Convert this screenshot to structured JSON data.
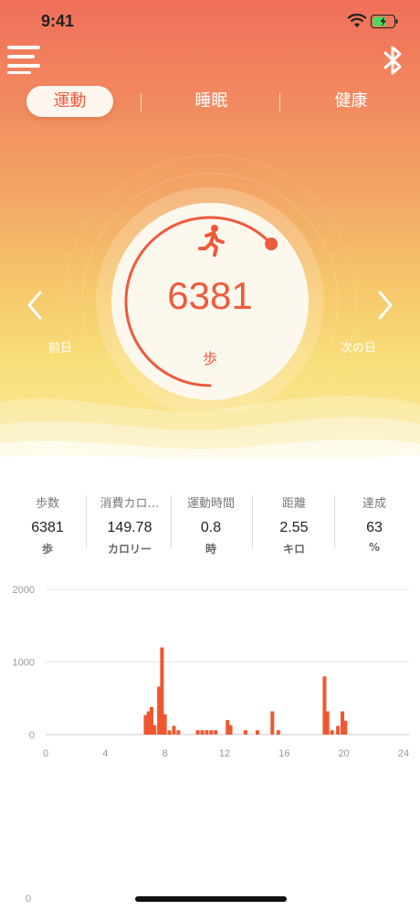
{
  "status": {
    "time": "9:41"
  },
  "tabs": [
    {
      "label": "運動",
      "active": true
    },
    {
      "label": "睡眠",
      "active": false
    },
    {
      "label": "健康",
      "active": false
    }
  ],
  "summary": {
    "steps": "6381",
    "unit": "歩",
    "prev_label": "前日",
    "next_label": "次の日",
    "goal_progress": 0.63,
    "icon": "running-person-icon"
  },
  "stats": [
    {
      "label": "歩数",
      "value": "6381",
      "unit": "歩"
    },
    {
      "label": "消費カロ…",
      "value": "149.78",
      "unit": "カロリー"
    },
    {
      "label": "運動時間",
      "value": "0.8",
      "unit": "時"
    },
    {
      "label": "距離",
      "value": "2.55",
      "unit": "キロ"
    },
    {
      "label": "達成",
      "value": "63",
      "unit": "%"
    }
  ],
  "colors": {
    "accent": "#ef5a3c",
    "bar": "#f0572f"
  },
  "chart_data": {
    "type": "bar",
    "x_ticks": [
      "0",
      "4",
      "8",
      "12",
      "16",
      "20",
      "24"
    ],
    "y_ticks": [
      "0",
      "1000",
      "2000"
    ],
    "ylim": [
      0,
      2000
    ],
    "xlim": [
      0,
      24
    ],
    "x": [
      6.7,
      6.9,
      7.1,
      7.3,
      7.6,
      7.8,
      8.0,
      8.3,
      8.6,
      8.9,
      10.2,
      10.5,
      10.8,
      11.1,
      11.4,
      12.2,
      12.4,
      13.4,
      14.2,
      15.2,
      15.6,
      18.7,
      18.9,
      19.2,
      19.6,
      19.9,
      20.1
    ],
    "values": [
      270,
      320,
      380,
      130,
      660,
      1200,
      280,
      60,
      120,
      60,
      60,
      60,
      60,
      60,
      60,
      200,
      130,
      60,
      60,
      320,
      60,
      800,
      320,
      60,
      120,
      320,
      190
    ],
    "bottom_label": "0"
  }
}
